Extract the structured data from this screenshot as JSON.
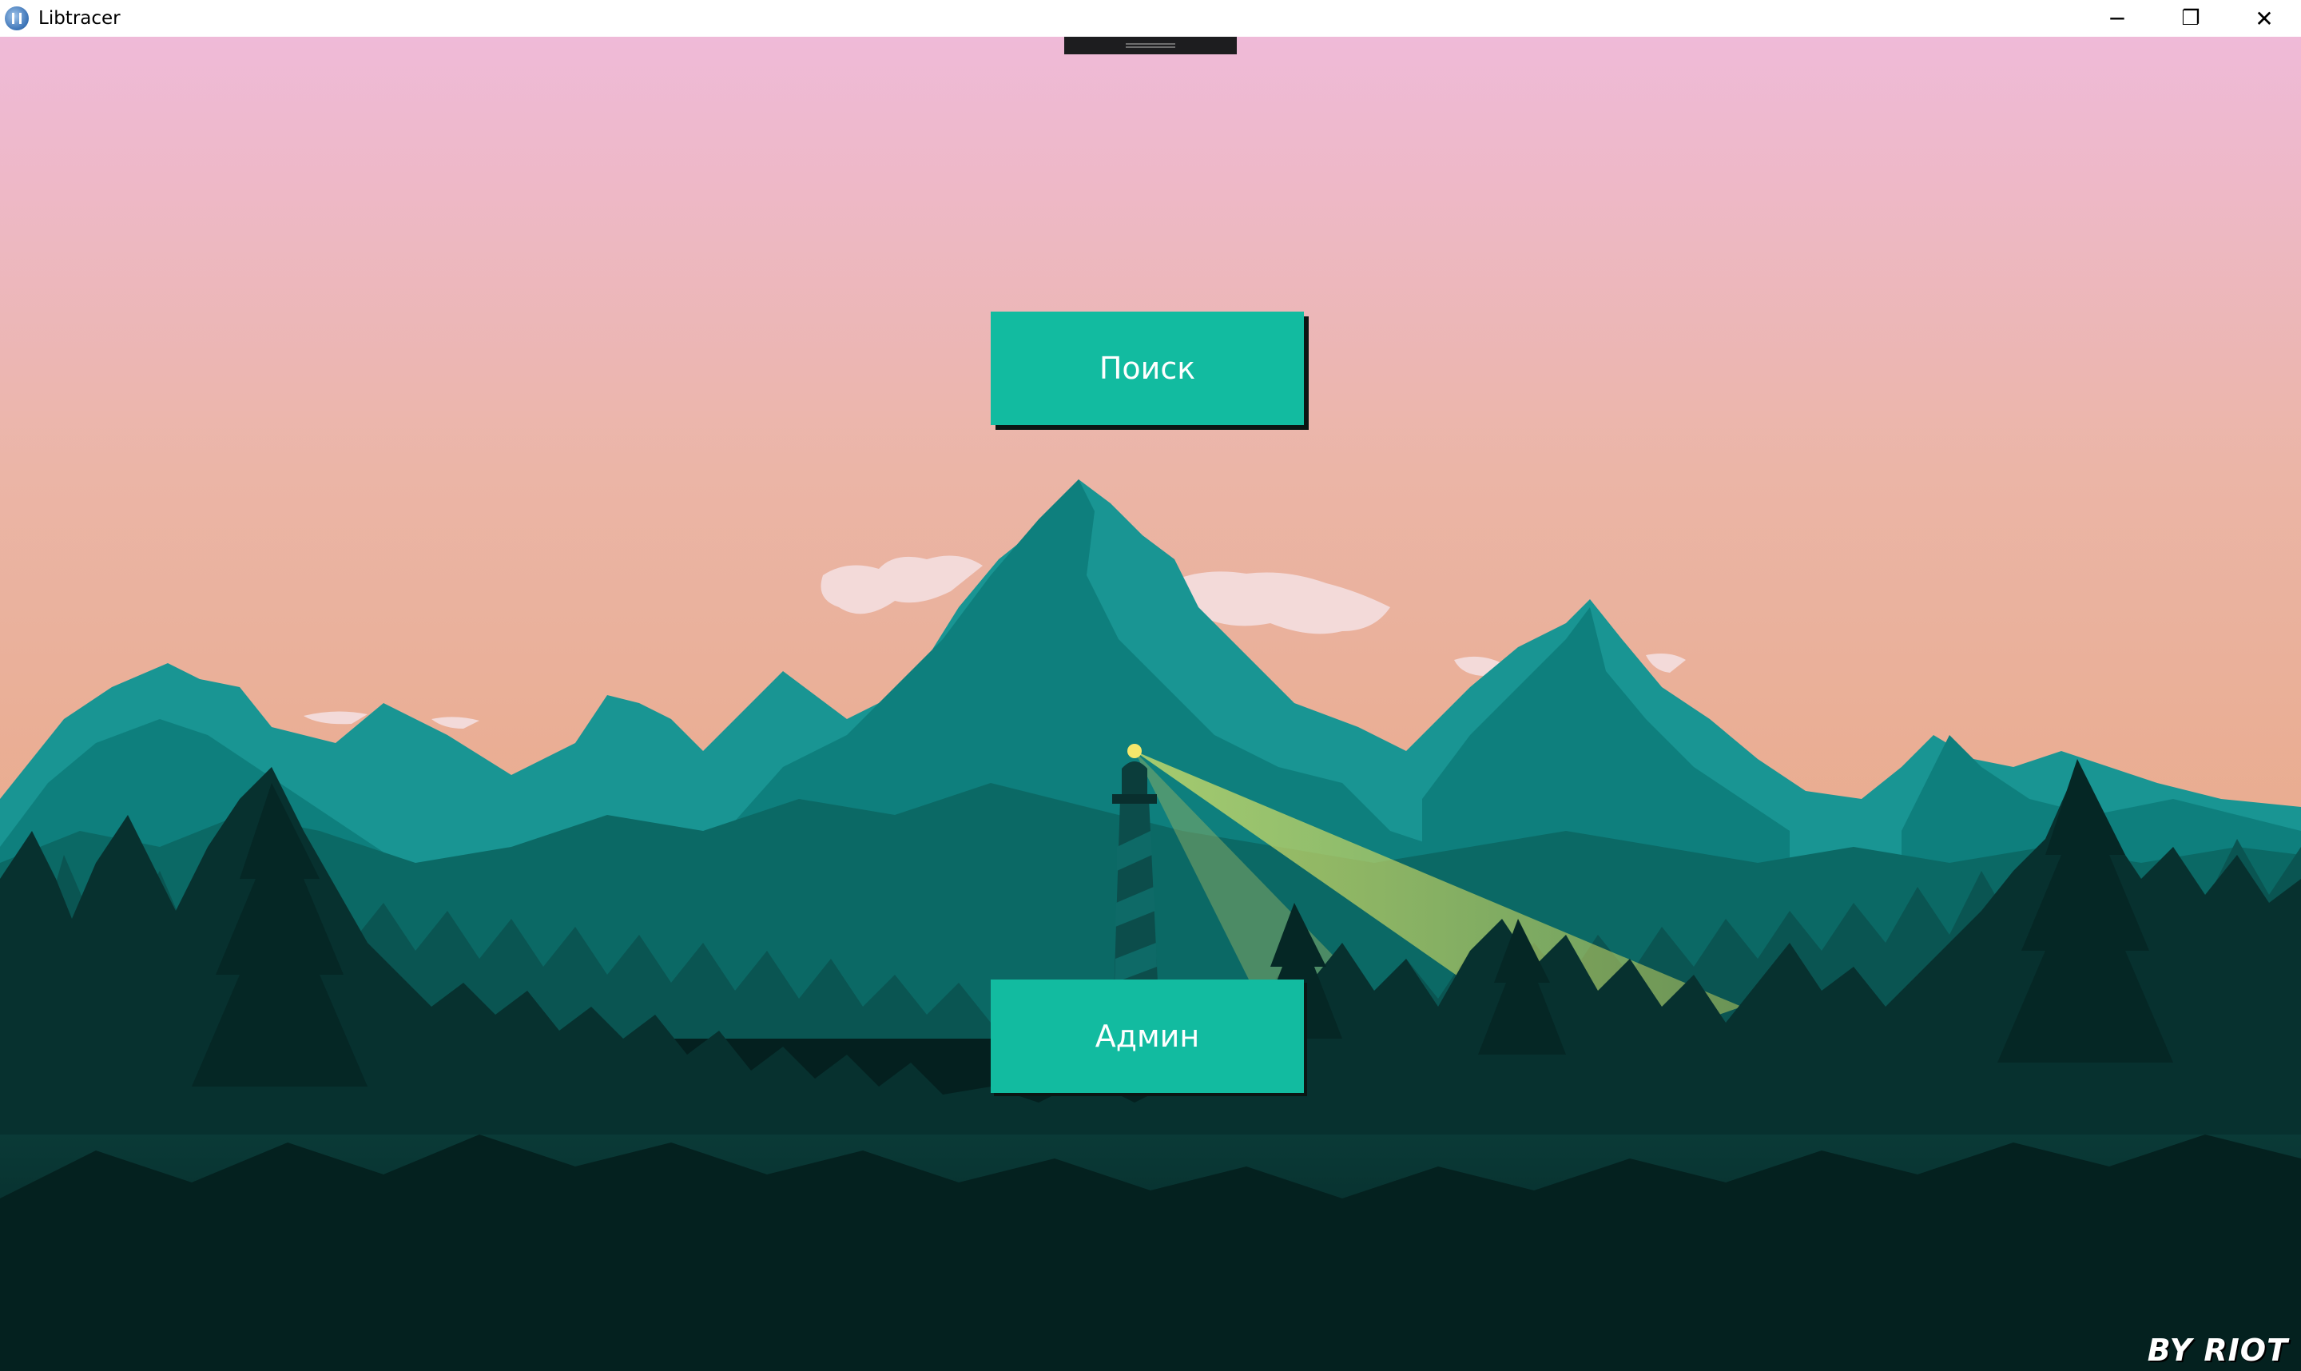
{
  "window": {
    "title": "Libtracer",
    "icon": "app-logo-icon",
    "controls": {
      "minimize": "─",
      "restore": "❐",
      "close": "✕"
    }
  },
  "menu": {
    "search_label": "Поиск",
    "admin_label": "Админ"
  },
  "credit": "BY RIOT",
  "colors": {
    "button": "#12bba0",
    "sky_top": "#efbad8",
    "sky_bottom": "#ebb095",
    "forest_dark": "#04201f"
  }
}
